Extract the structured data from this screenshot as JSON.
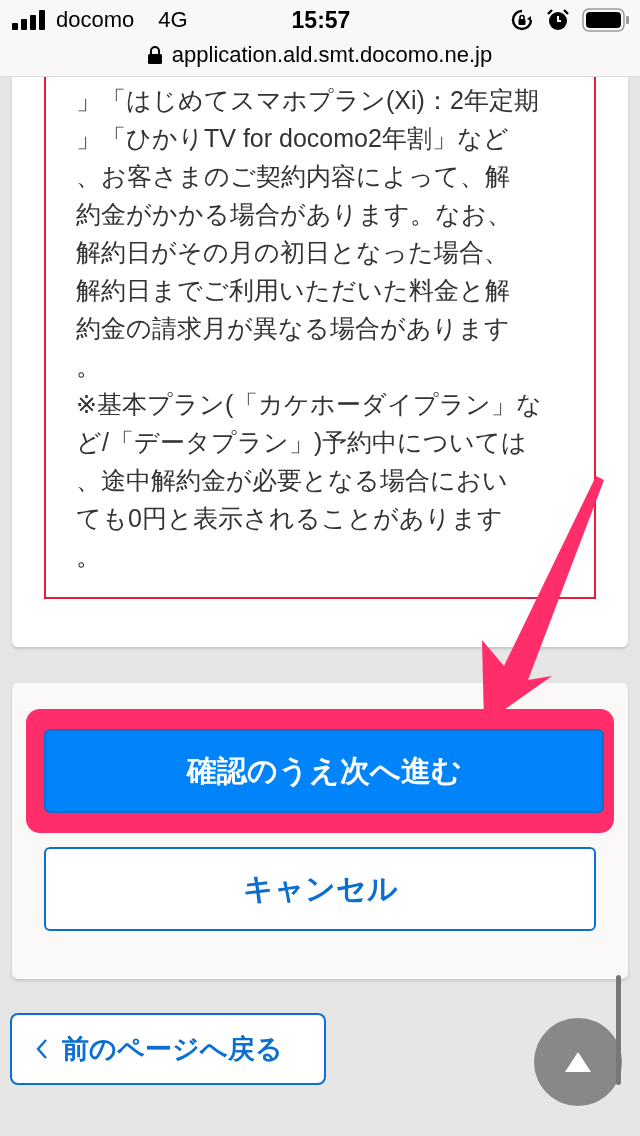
{
  "status_bar": {
    "carrier": "docomo",
    "network": "4G",
    "time": "15:57"
  },
  "address_bar": {
    "url": "application.ald.smt.docomo.ne.jp"
  },
  "notice": {
    "lines": [
      "」「はじめてスマホプラン(Xi)：2年定期",
      "」「ひかりTV for docomo2年割」など",
      "、お客さまのご契約内容によって、解",
      "約金がかかる場合があります。なお、",
      "解約日がその月の初日となった場合、",
      "解約日までご利用いただいた料金と解",
      "約金の請求月が異なる場合があります",
      "。",
      "※基本プラン(「カケホーダイプラン」な",
      "ど/「データプラン」)予約中については",
      "、途中解約金が必要となる場合におい",
      "ても0円と表示されることがあります",
      "。"
    ]
  },
  "actions": [
    {
      "kind": "primary",
      "label": "確認のうえ次へ進む",
      "highlighted": true
    },
    {
      "kind": "secondary",
      "label": "キャンセル",
      "highlighted": false
    }
  ],
  "back_link": {
    "label": "前のページへ戻る"
  }
}
